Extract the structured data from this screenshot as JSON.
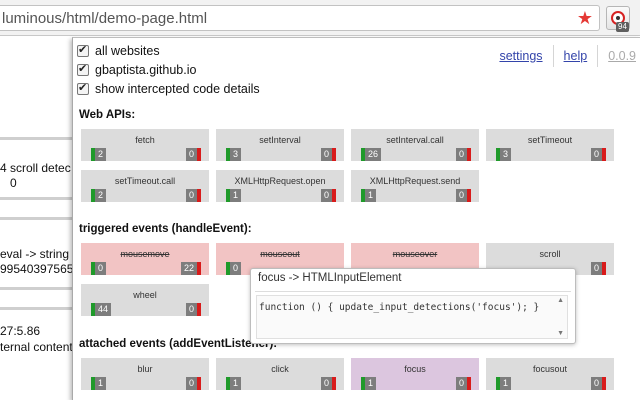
{
  "browser": {
    "url": "luminous/html/demo-page.html",
    "extension_badge": "94"
  },
  "background_page": {
    "lines": [
      "4 scroll detec",
      "0",
      "eval -> string",
      "99540397565",
      "27:5.86",
      "ternal content"
    ]
  },
  "popup": {
    "options": [
      {
        "label": "all websites",
        "checked": true
      },
      {
        "label": "gbaptista.github.io",
        "checked": true
      },
      {
        "label": "show intercepted code details",
        "checked": true
      }
    ],
    "links": {
      "settings": "settings",
      "help": "help",
      "version": "0.0.9"
    },
    "sections": {
      "web_apis": "Web APIs:",
      "triggered": "triggered events (handleEvent):",
      "attached": "attached events (addEventListener):"
    },
    "web_apis": [
      {
        "name": "fetch",
        "allowed": "2",
        "blocked": "0"
      },
      {
        "name": "setInterval",
        "allowed": "3",
        "blocked": "0"
      },
      {
        "name": "setInterval.call",
        "allowed": "26",
        "blocked": "0"
      },
      {
        "name": "setTimeout",
        "allowed": "3",
        "blocked": "0"
      },
      {
        "name": "setTimeout.call",
        "allowed": "2",
        "blocked": "0"
      },
      {
        "name": "XMLHttpRequest.open",
        "allowed": "1",
        "blocked": "0"
      },
      {
        "name": "XMLHttpRequest.send",
        "allowed": "1",
        "blocked": "0"
      }
    ],
    "triggered": [
      {
        "name": "mousemove",
        "allowed": "0",
        "blocked": "22",
        "state": "blocked"
      },
      {
        "name": "mouseout",
        "allowed": "0",
        "blocked": "",
        "state": "blocked"
      },
      {
        "name": "mouseover",
        "allowed": "",
        "blocked": "",
        "state": "blocked"
      },
      {
        "name": "scroll",
        "allowed": "",
        "blocked": "0",
        "state": "normal"
      },
      {
        "name": "wheel",
        "allowed": "44",
        "blocked": "0",
        "state": "normal"
      }
    ],
    "attached": [
      {
        "name": "blur",
        "allowed": "1",
        "blocked": "0",
        "state": "normal"
      },
      {
        "name": "click",
        "allowed": "1",
        "blocked": "0",
        "state": "normal"
      },
      {
        "name": "focus",
        "allowed": "1",
        "blocked": "0",
        "state": "highlight"
      },
      {
        "name": "focusout",
        "allowed": "1",
        "blocked": "0",
        "state": "normal"
      }
    ],
    "tooltip": {
      "title": "focus -> HTMLInputElement",
      "code": "function () { update_input_detections('focus'); }"
    }
  },
  "colors": {
    "allowed_marker": "#1f9a2a",
    "blocked_marker": "#d81b1b",
    "blocked_cell": "#f2c4c4",
    "highlight_cell": "#dcc6df",
    "link": "#3344aa"
  }
}
